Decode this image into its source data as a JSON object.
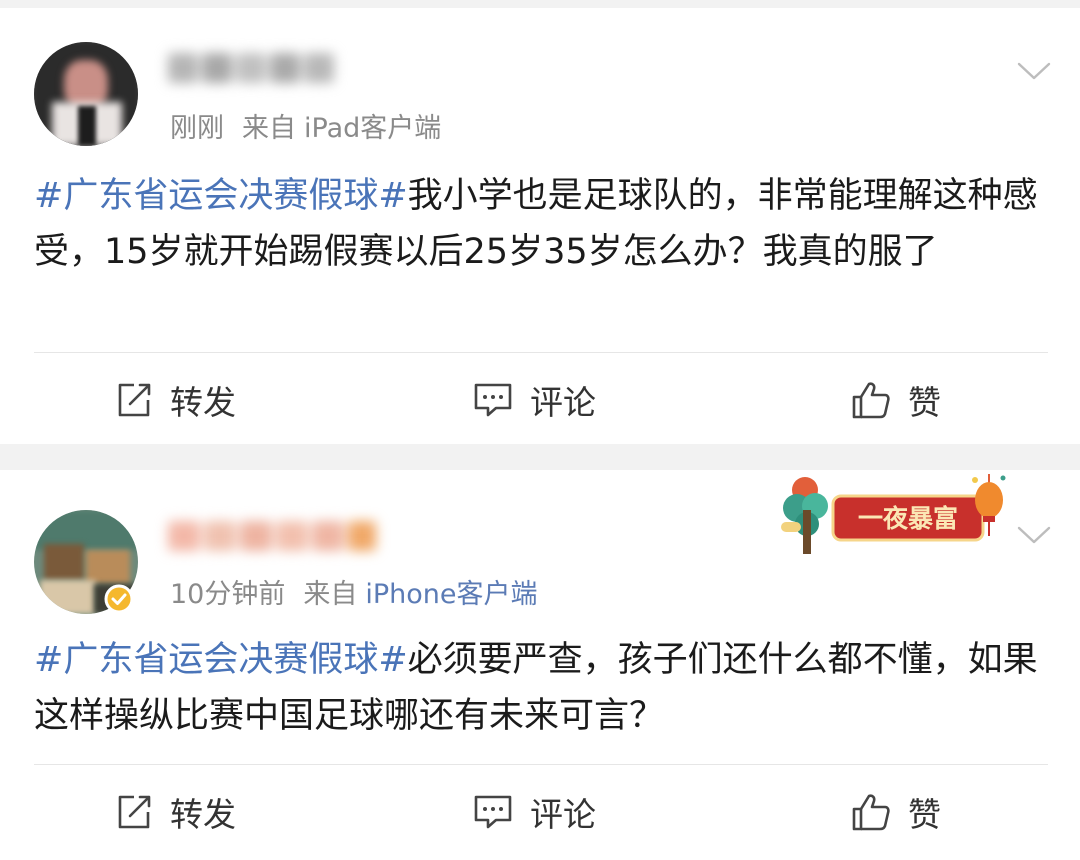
{
  "posts": [
    {
      "time": "刚刚",
      "source_prefix": "来自",
      "source": "iPad客户端",
      "hashtag": "#广东省运会决赛假球#",
      "body": "我小学也是足球队的，非常能理解这种感受，15岁就开始踢假赛以后25岁35岁怎么办？我真的服了",
      "actions": {
        "repost": "转发",
        "comment": "评论",
        "like": "赞"
      }
    },
    {
      "time": "10分钟前",
      "source_prefix": "来自",
      "source": "iPhone客户端",
      "badge": "一夜暴富",
      "hashtag": "#广东省运会决赛假球#",
      "body": "必须要严查，孩子们还什么都不懂，如果这样操纵比赛中国足球哪还有未来可言？",
      "actions": {
        "repost": "转发",
        "comment": "评论",
        "like": "赞"
      }
    }
  ],
  "colors": {
    "hashtag": "#4a74b8",
    "source_link": "#5b7bb5",
    "meta": "#8a8a8a",
    "badge_red": "#c8302c",
    "badge_gold": "#f6d58a"
  },
  "icons": [
    "repost-icon",
    "comment-icon",
    "like-icon",
    "chevron-down-icon",
    "verified-icon"
  ]
}
